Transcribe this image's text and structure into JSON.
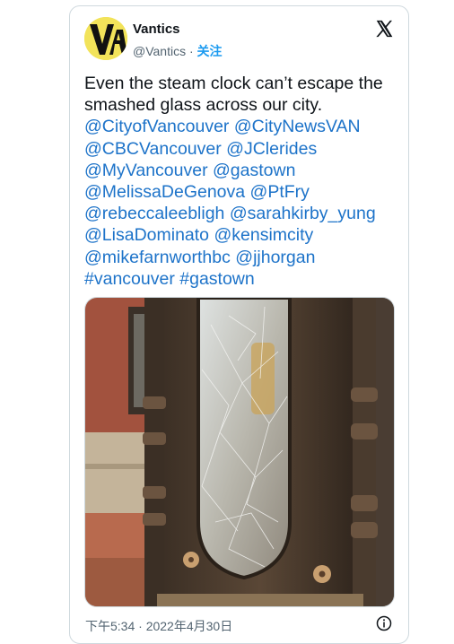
{
  "author": {
    "name": "Vantics",
    "handle": "@Vantics",
    "separator": " · ",
    "follow_label": "关注",
    "avatar_letters": "VA"
  },
  "tweet": {
    "line1": "Even the steam clock can’t escape the smashed glass across our city.",
    "mentions": [
      "@CityofVancouver",
      "@CityNewsVAN",
      "@CBCVancouver",
      "@JClerides",
      "@MyVancouver",
      "@gastown",
      "@MelissaDeGenova",
      "@PtFry",
      "@rebeccaleebligh",
      "@sarahkirby_yung",
      "@LisaDominato",
      "@kensimcity",
      "@mikefarnworthbc",
      "@jjhorgan"
    ],
    "hashtags": [
      "#vancouver",
      "#gastown"
    ]
  },
  "timestamp": "下午5:34 · 2022年4月30日",
  "colors": {
    "link": "#1d73c9",
    "follow": "#1d9bf0",
    "avatar_bg": "#f2e35a"
  },
  "icons": {
    "close": "x-logo-icon",
    "info": "info-icon"
  }
}
